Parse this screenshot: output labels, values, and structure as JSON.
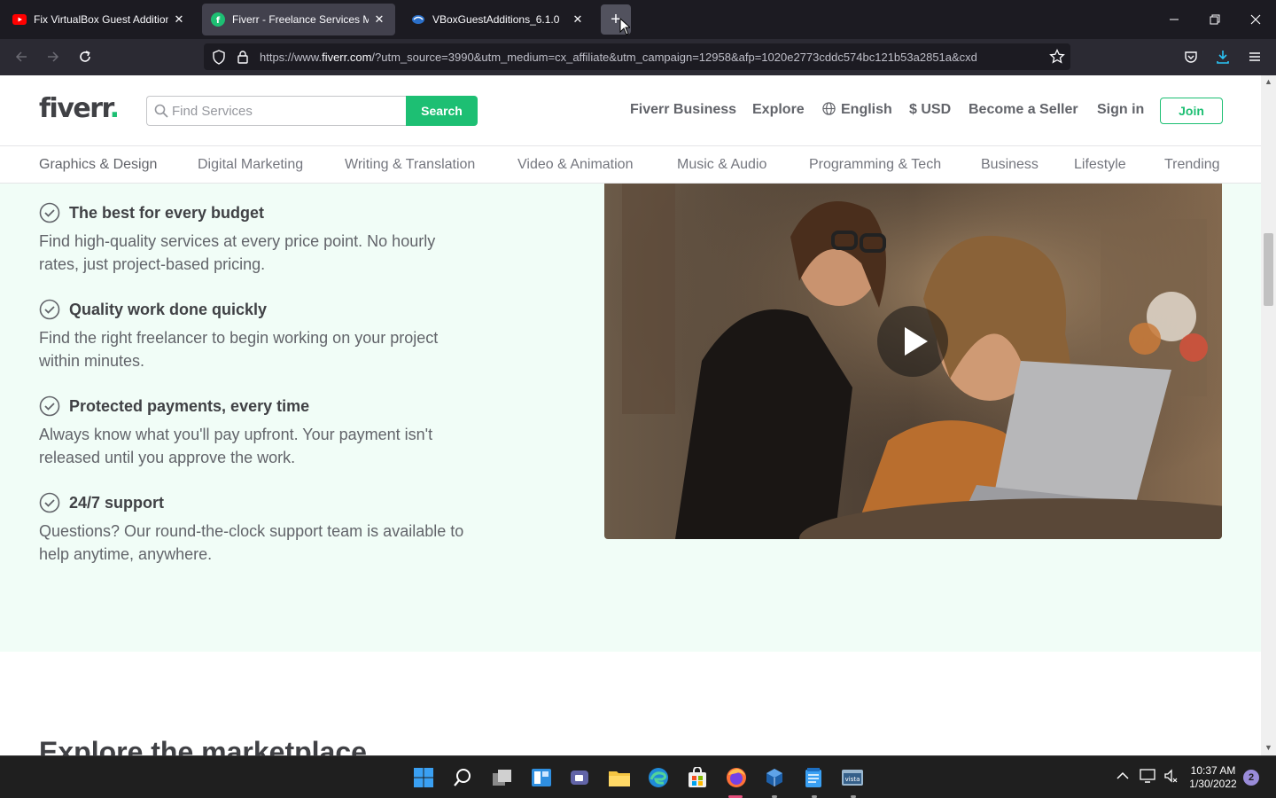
{
  "browser": {
    "tabs": [
      {
        "title": "Fix VirtualBox Guest Additions E",
        "icon": "youtube-icon"
      },
      {
        "title": "Fiverr - Freelance Services Mark",
        "icon": "fiverr-icon",
        "active": true
      },
      {
        "title": "VBoxGuestAdditions_6.1.0",
        "icon": "virtualbox-icon"
      }
    ],
    "new_tab": "+",
    "url_prefix": "https://www.",
    "url_host": "fiverr.com",
    "url_rest": "/?utm_source=3990&utm_medium=cx_affiliate&utm_campaign=12958&afp=1020e2773cddc574bc121b53a2851a&cxd"
  },
  "header": {
    "logo": "fiverr",
    "logo_dot": ".",
    "search_placeholder": "Find Services",
    "search_button": "Search",
    "nav": {
      "business": "Fiverr Business",
      "explore": "Explore",
      "language": "English",
      "currency": "$ USD",
      "seller": "Become a Seller",
      "signin": "Sign in",
      "join": "Join"
    }
  },
  "categories": [
    "Graphics & Design",
    "Digital Marketing",
    "Writing & Translation",
    "Video & Animation",
    "Music & Audio",
    "Programming & Tech",
    "Business",
    "Lifestyle",
    "Trending"
  ],
  "features": [
    {
      "title": "The best for every budget",
      "desc": "Find high-quality services at every price point. No hourly rates, just project-based pricing."
    },
    {
      "title": "Quality work done quickly",
      "desc": "Find the right freelancer to begin working on your project within minutes."
    },
    {
      "title": "Protected payments, every time",
      "desc": "Always know what you'll pay upfront. Your payment isn't released until you approve the work."
    },
    {
      "title": "24/7 support",
      "desc": "Questions? Our round-the-clock support team is available to help anytime, anywhere."
    }
  ],
  "explore_heading": "Explore the marketplace",
  "taskbar": {
    "time": "10:37 AM",
    "date": "1/30/2022",
    "notifications": "2"
  },
  "colors": {
    "brand_green": "#1dbf73",
    "section_bg": "#f1fdf7",
    "text_dark": "#404145"
  }
}
